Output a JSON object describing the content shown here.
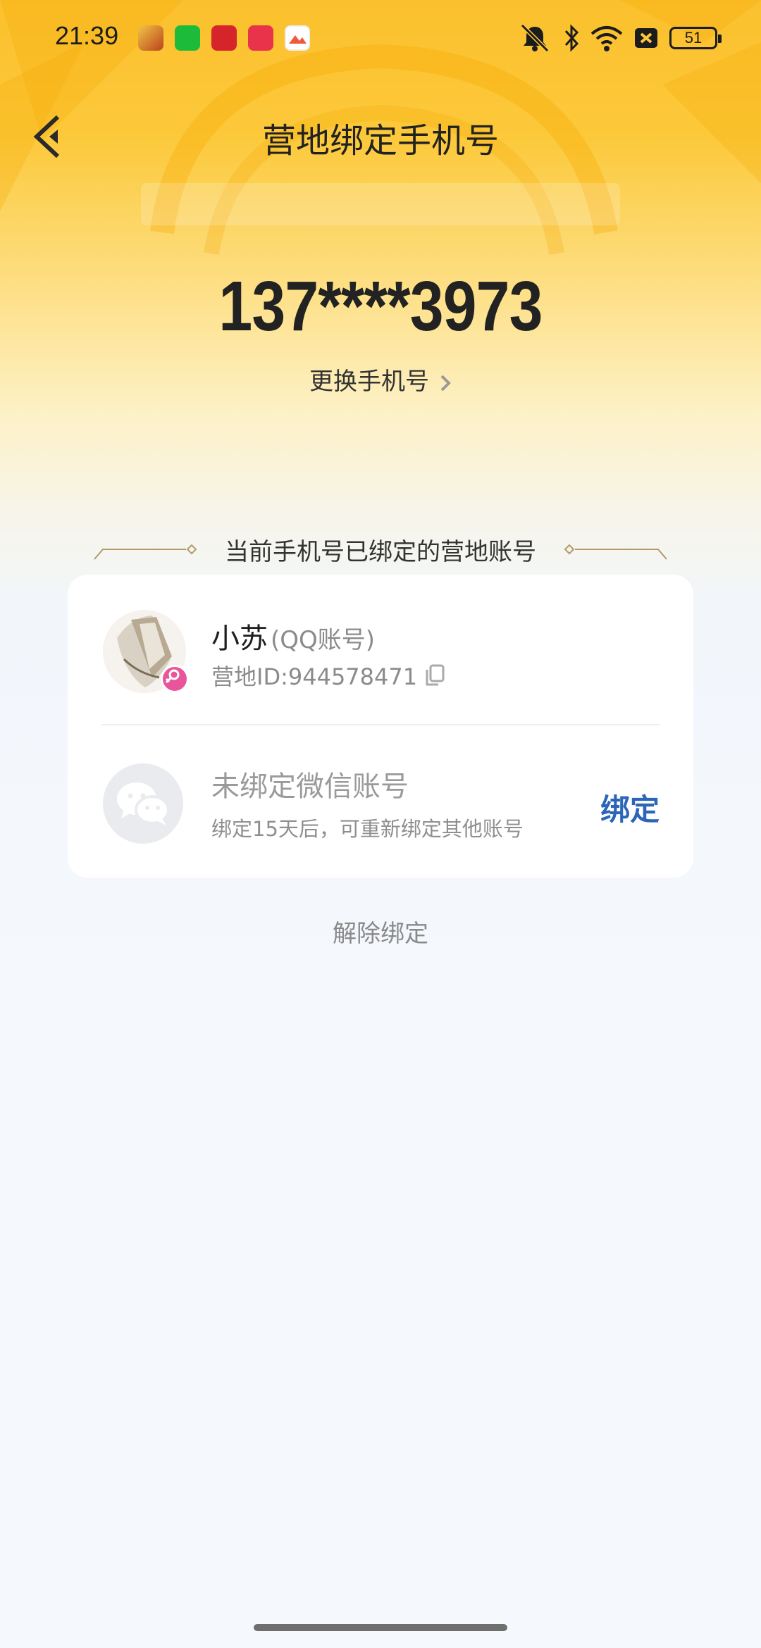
{
  "status_bar": {
    "time": "21:39",
    "battery": "51",
    "app_icons": [
      {
        "name": "game-app-icon",
        "color": "#d98c1f"
      },
      {
        "name": "green-app-icon",
        "color": "#1dbb3a"
      },
      {
        "name": "red-alert-app-icon",
        "color": "#d6252a"
      },
      {
        "name": "music-app-icon",
        "color": "#e8334a"
      },
      {
        "name": "gallery-app-icon",
        "color": "#f05a3a"
      }
    ]
  },
  "header": {
    "title": "营地绑定手机号"
  },
  "phone": {
    "number": "137****3973",
    "change_label": "更换手机号"
  },
  "section": {
    "title": "当前手机号已绑定的营地账号"
  },
  "qq_account": {
    "nickname": "小苏",
    "type": "(QQ账号)",
    "camp_id": "营地ID:944578471"
  },
  "wechat_account": {
    "title": "未绑定微信账号",
    "subtitle": "绑定15天后，可重新绑定其他账号",
    "bind_label": "绑定"
  },
  "footer": {
    "unbind_label": "解除绑定"
  },
  "colors": {
    "accent_blue": "#2c66b8",
    "header_yellow": "#fbc02d",
    "gender_badge": "#e9559a"
  }
}
